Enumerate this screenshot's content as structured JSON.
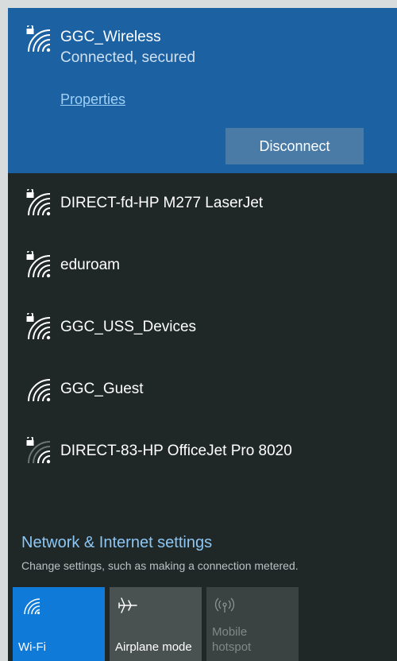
{
  "connected": {
    "ssid": "GGC_Wireless",
    "status": "Connected, secured",
    "properties_label": "Properties",
    "disconnect_label": "Disconnect",
    "icon": "wifi-secured-icon"
  },
  "networks": [
    {
      "ssid": "DIRECT-fd-HP M277 LaserJet",
      "secured": true,
      "icon": "wifi-secured-icon"
    },
    {
      "ssid": "eduroam",
      "secured": true,
      "icon": "wifi-secured-icon"
    },
    {
      "ssid": "GGC_USS_Devices",
      "secured": true,
      "icon": "wifi-secured-icon"
    },
    {
      "ssid": "GGC_Guest",
      "secured": false,
      "icon": "wifi-icon"
    },
    {
      "ssid": "DIRECT-83-HP OfficeJet Pro 8020",
      "secured": true,
      "icon": "wifi-weak-secured-icon"
    }
  ],
  "footer": {
    "settings_link": "Network & Internet settings",
    "settings_subtext": "Change settings, such as making a connection metered."
  },
  "quick_actions": [
    {
      "label": "Wi-Fi",
      "icon": "wifi-icon",
      "state": "on",
      "color": "#0f7ad8"
    },
    {
      "label": "Airplane mode",
      "icon": "airplane-icon",
      "state": "off",
      "color": "#4a5151"
    },
    {
      "label": "Mobile\nhotspot",
      "icon": "hotspot-icon",
      "state": "disabled",
      "color": "#3a4242"
    }
  ],
  "colors": {
    "accent": "#1c62a3",
    "background": "#1f2727",
    "link": "#8cc7f5"
  }
}
